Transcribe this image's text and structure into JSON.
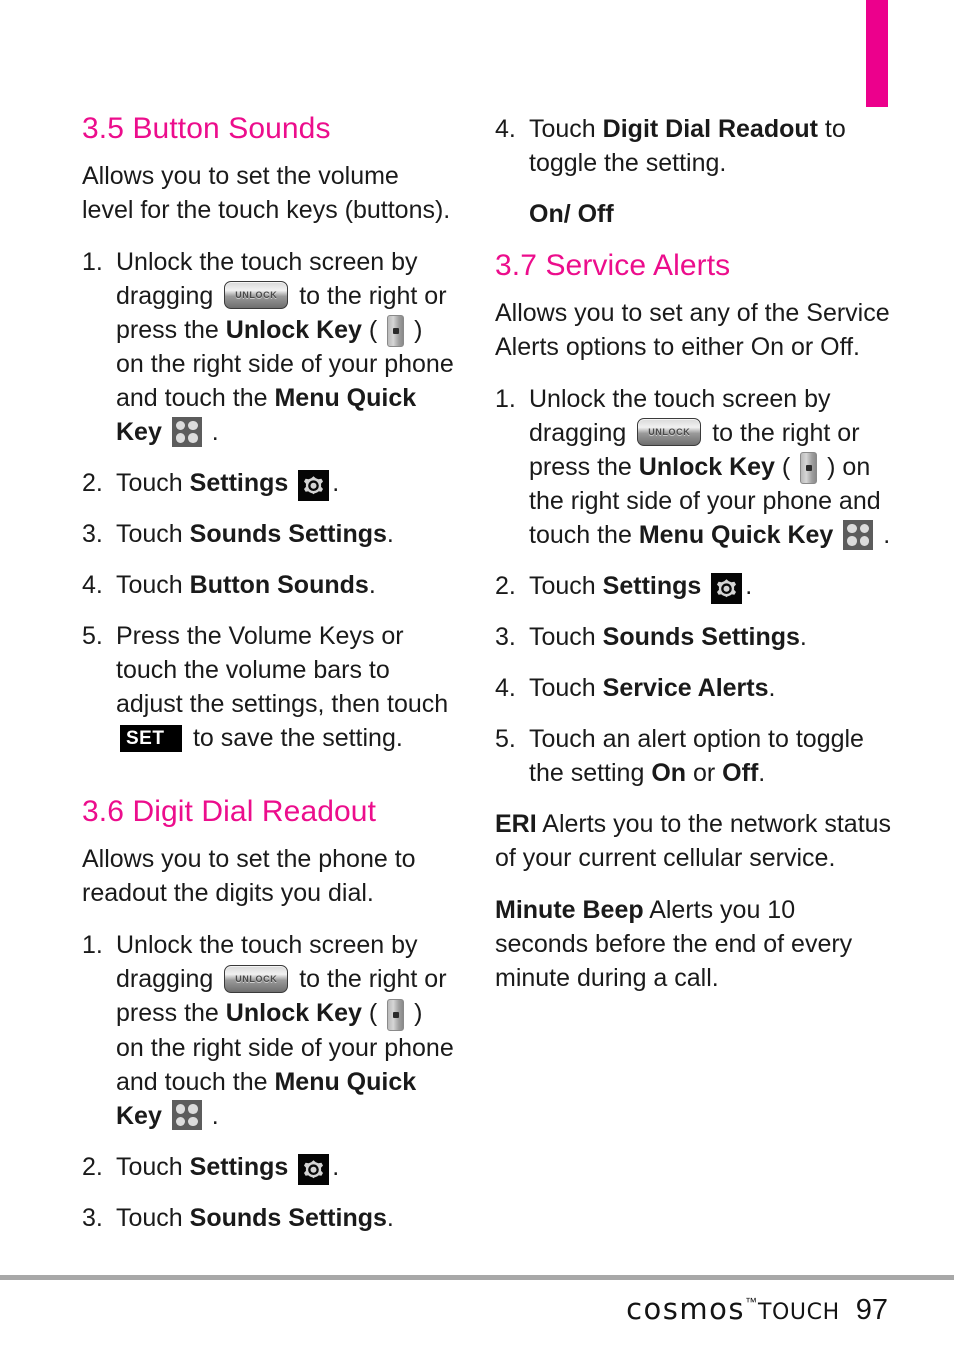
{
  "page": {
    "number": "97",
    "tab_color": "#ec008c",
    "heading_color": "#ec0d8c"
  },
  "footer": {
    "brand": "cosmos",
    "trademark": "™",
    "sub_brand": "TOUCH",
    "page_number": "97"
  },
  "icons": {
    "unlock_slider_label": "UNLOCK",
    "set_button_label": "SET"
  },
  "left_column": {
    "section_35": {
      "heading": "3.5 Button Sounds",
      "intro": "Allows you to set the volume level for the touch keys (buttons).",
      "steps": {
        "s1_num": "1.",
        "s1_a": "Unlock the touch screen by dragging",
        "s1_b": "to the right or press the",
        "s1_bold1": "Unlock Key",
        "s1_c": "(",
        "s1_d": ") on the right side of your phone and touch the",
        "s1_bold2": "Menu Quick Key",
        "s1_e": ".",
        "s2_num": "2.",
        "s2_a": "Touch",
        "s2_bold": "Settings",
        "s2_b": ".",
        "s3_num": "3.",
        "s3_a": "Touch",
        "s3_bold": "Sounds Settings",
        "s3_b": ".",
        "s4_num": "4.",
        "s4_a": "Touch",
        "s4_bold": "Button Sounds",
        "s4_b": ".",
        "s5_num": "5.",
        "s5_a": "Press the Volume Keys or touch the volume bars to adjust the settings, then touch",
        "s5_b": "to save the setting."
      }
    },
    "section_36": {
      "heading": "3.6 Digit Dial Readout",
      "intro": "Allows you to set the phone to readout the digits you dial.",
      "steps": {
        "s1_num": "1.",
        "s1_a": "Unlock the touch screen by dragging",
        "s1_b": "to the right or press the",
        "s1_bold1": "Unlock Key",
        "s1_c": "(",
        "s1_d": ") on the right side of your phone and touch the",
        "s1_bold2": "Menu Quick Key",
        "s1_e": ".",
        "s2_num": "2.",
        "s2_a": "Touch",
        "s2_bold": "Settings",
        "s2_b": ".",
        "s3_num": "3.",
        "s3_a": "Touch",
        "s3_bold": "Sounds Settings",
        "s3_b": "."
      }
    }
  },
  "right_column": {
    "section_36_cont": {
      "s4_num": "4.",
      "s4_a": "Touch",
      "s4_bold": "Digit Dial Readout",
      "s4_b": "to toggle the setting.",
      "options": "On/ Off"
    },
    "section_37": {
      "heading": "3.7 Service Alerts",
      "intro": "Allows you to set any of the Service Alerts options to either On or Off.",
      "steps": {
        "s1_num": "1.",
        "s1_a": "Unlock the touch screen by dragging",
        "s1_b": "to the right or press the",
        "s1_bold1": "Unlock Key",
        "s1_c": "(",
        "s1_d": ") on the right side of your phone and touch the",
        "s1_bold2": "Menu Quick Key",
        "s1_e": ".",
        "s2_num": "2.",
        "s2_a": "Touch",
        "s2_bold": "Settings",
        "s2_b": ".",
        "s3_num": "3.",
        "s3_a": "Touch",
        "s3_bold": "Sounds Settings",
        "s3_b": ".",
        "s4_num": "4.",
        "s4_a": "Touch ",
        "s4_bold": "Service Alerts",
        "s4_b": ".",
        "s5_num": "5.",
        "s5_a": "Touch an alert option to toggle the setting",
        "s5_bold1": "On",
        "s5_b": "or",
        "s5_bold2": "Off",
        "s5_c": "."
      },
      "glossary": {
        "eri_term": "ERI",
        "eri_desc": "Alerts you to the network status of your current cellular service.",
        "beep_term": "Minute Beep",
        "beep_desc": "Alerts you 10 seconds before the end of every minute during a call."
      }
    }
  }
}
